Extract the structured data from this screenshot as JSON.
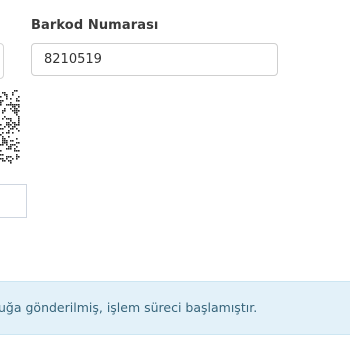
{
  "barcode": {
    "label": "Barkod Numarası",
    "value": "8210519"
  },
  "alert": {
    "message": "uğa gönderilmiş, işlem süreci başlamıştır."
  },
  "icons": {
    "qr": "qr-code-icon"
  },
  "colors": {
    "label_text": "#3a3a3a",
    "input_border": "#cfcfcf",
    "alert_background": "#e3f1f9",
    "alert_text": "#36647a"
  }
}
